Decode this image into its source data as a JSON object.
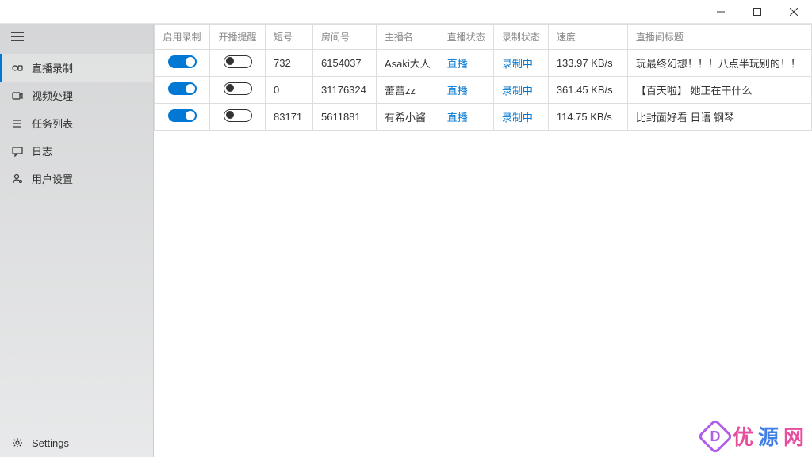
{
  "sidebar": {
    "items": [
      {
        "label": "直播录制",
        "icon": "record"
      },
      {
        "label": "视频处理",
        "icon": "video"
      },
      {
        "label": "任务列表",
        "icon": "list"
      },
      {
        "label": "日志",
        "icon": "chat"
      },
      {
        "label": "用户设置",
        "icon": "user"
      }
    ],
    "settings_label": "Settings"
  },
  "table": {
    "headers": {
      "enable": "启用录制",
      "alert": "开播提醒",
      "short": "短号",
      "room": "房间号",
      "name": "主播名",
      "live": "直播状态",
      "rec": "录制状态",
      "speed": "速度",
      "title": "直播间标题"
    },
    "rows": [
      {
        "enable": true,
        "alert": false,
        "short": "732",
        "room": "6154037",
        "name": "Asaki大人",
        "live": "直播",
        "rec": "录制中",
        "speed": "133.97 KB/s",
        "title": "玩最终幻想！！！八点半玩别的！！"
      },
      {
        "enable": true,
        "alert": false,
        "short": "0",
        "room": "31176324",
        "name": "蕾蕾zz",
        "live": "直播",
        "rec": "录制中",
        "speed": "361.45 KB/s",
        "title": "【百天啦】 她正在干什么"
      },
      {
        "enable": true,
        "alert": false,
        "short": "83171",
        "room": "5611881",
        "name": "有希小酱",
        "live": "直播",
        "rec": "录制中",
        "speed": "114.75 KB/s",
        "title": "比封面好看 日语  钢琴"
      }
    ]
  },
  "watermark": {
    "t1": "优",
    "t2": "源",
    "t3": "网"
  }
}
